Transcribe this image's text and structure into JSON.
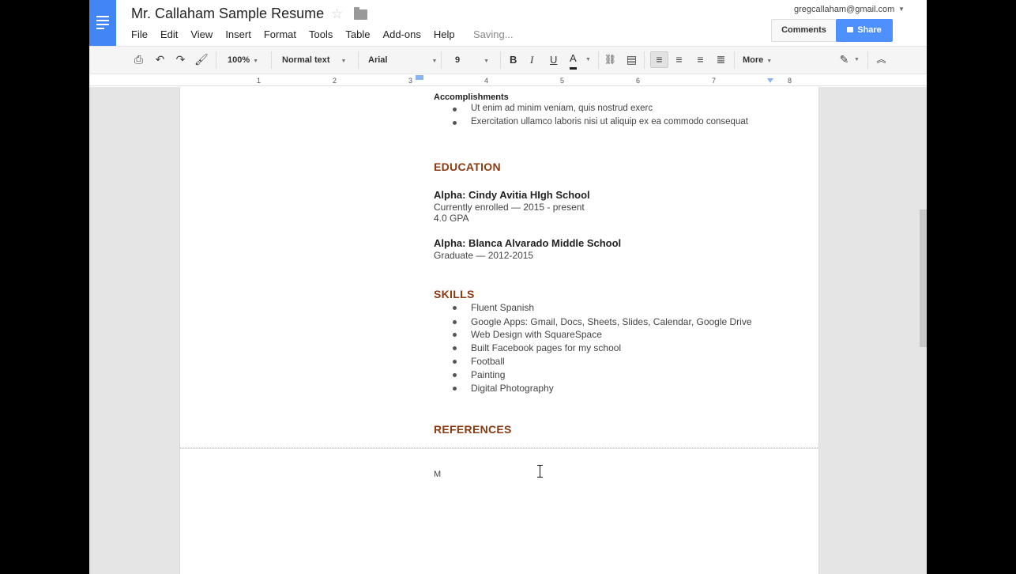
{
  "header": {
    "title": "Mr. Callaham Sample Resume",
    "menu": [
      "File",
      "Edit",
      "View",
      "Insert",
      "Format",
      "Tools",
      "Table",
      "Add-ons",
      "Help"
    ],
    "saving_status": "Saving...",
    "account_email": "gregcallaham@gmail.com",
    "comments_label": "Comments",
    "share_label": "Share",
    "brand_color": "#4285f4",
    "share_color": "#4d90fe"
  },
  "toolbar": {
    "zoom": "100%",
    "style": "Normal text",
    "font": "Arial",
    "size": "9",
    "bold": "B",
    "italic": "I",
    "underline": "U",
    "text_color": "A",
    "more": "More"
  },
  "ruler": {
    "numbers": [
      "1",
      "2",
      "3",
      "4",
      "5",
      "6",
      "7",
      "8"
    ]
  },
  "document": {
    "accomplishments": {
      "heading": "Accomplishments",
      "items": [
        "Ut enim ad minim veniam, quis nostrud exerc",
        "Exercitation ullamco laboris nisi ut aliquip ex ea commodo consequat"
      ]
    },
    "education": {
      "heading": "EDUCATION",
      "schools": [
        {
          "name": "Alpha: Cindy Avitia HIgh School",
          "line1": "Currently enrolled — 2015 - present",
          "line2": "4.0 GPA"
        },
        {
          "name": "Alpha: Blanca Alvarado Middle School",
          "line1": "Graduate — 2012-2015"
        }
      ]
    },
    "skills": {
      "heading": "SKILLS",
      "items": [
        "Fluent Spanish",
        "Google Apps: Gmail, Docs, Sheets, Slides, Calendar, Google Drive",
        "Web Design with SquareSpace",
        "Built Facebook pages for my school",
        "Football",
        "Painting",
        "Digital Photography"
      ]
    },
    "references": {
      "heading": "REFERENCES"
    },
    "page2_text": "M",
    "heading_color": "#8b3a10"
  }
}
